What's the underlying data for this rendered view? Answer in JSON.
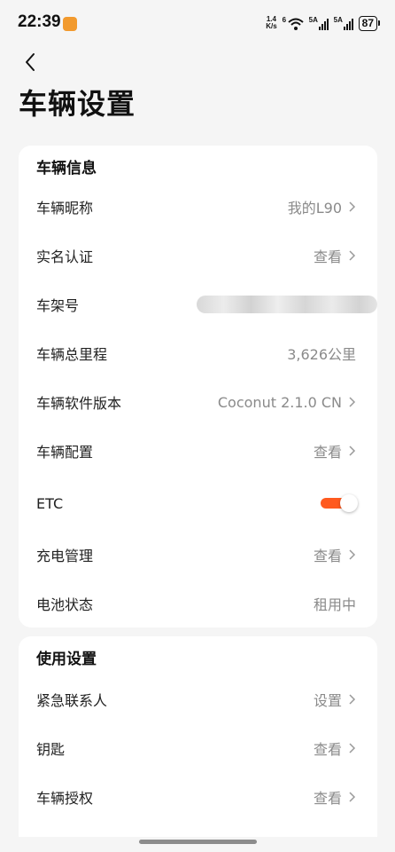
{
  "status_bar": {
    "time": "22:39",
    "net_speed_value": "1.4",
    "net_speed_unit": "K/s",
    "wifi_label": "6",
    "sim1_label": "5A",
    "sim2_label": "5A",
    "battery": "87",
    "app_icon_color": "#f29a2e"
  },
  "header": {
    "back_icon": "chevron-left-icon",
    "title": "车辆设置"
  },
  "vehicle_info": {
    "section_title": "车辆信息",
    "rows": [
      {
        "label": "车辆昵称",
        "value": "我的L90",
        "chevron": true
      },
      {
        "label": "实名认证",
        "value": "查看",
        "chevron": true
      },
      {
        "label": "车架号",
        "value": "",
        "blurred": true
      },
      {
        "label": "车辆总里程",
        "value": "3,626公里",
        "chevron": false
      },
      {
        "label": "车辆软件版本",
        "value": "Coconut 2.1.0 CN",
        "chevron": true
      },
      {
        "label": "车辆配置",
        "value": "查看",
        "chevron": true
      },
      {
        "label": "ETC",
        "toggle_on": true
      },
      {
        "label": "充电管理",
        "value": "查看",
        "chevron": true
      },
      {
        "label": "电池状态",
        "value": "租用中",
        "chevron": false
      }
    ]
  },
  "usage_settings": {
    "section_title": "使用设置",
    "rows": [
      {
        "label": "紧急联系人",
        "value": "设置",
        "chevron": true
      },
      {
        "label": "钥匙",
        "value": "查看",
        "chevron": true
      },
      {
        "label": "车辆授权",
        "value": "查看",
        "chevron": true
      }
    ]
  },
  "colors": {
    "accent": "#ff5a1f",
    "background": "#f5f5f5",
    "card": "#ffffff",
    "value_text": "#8a8a8a"
  }
}
